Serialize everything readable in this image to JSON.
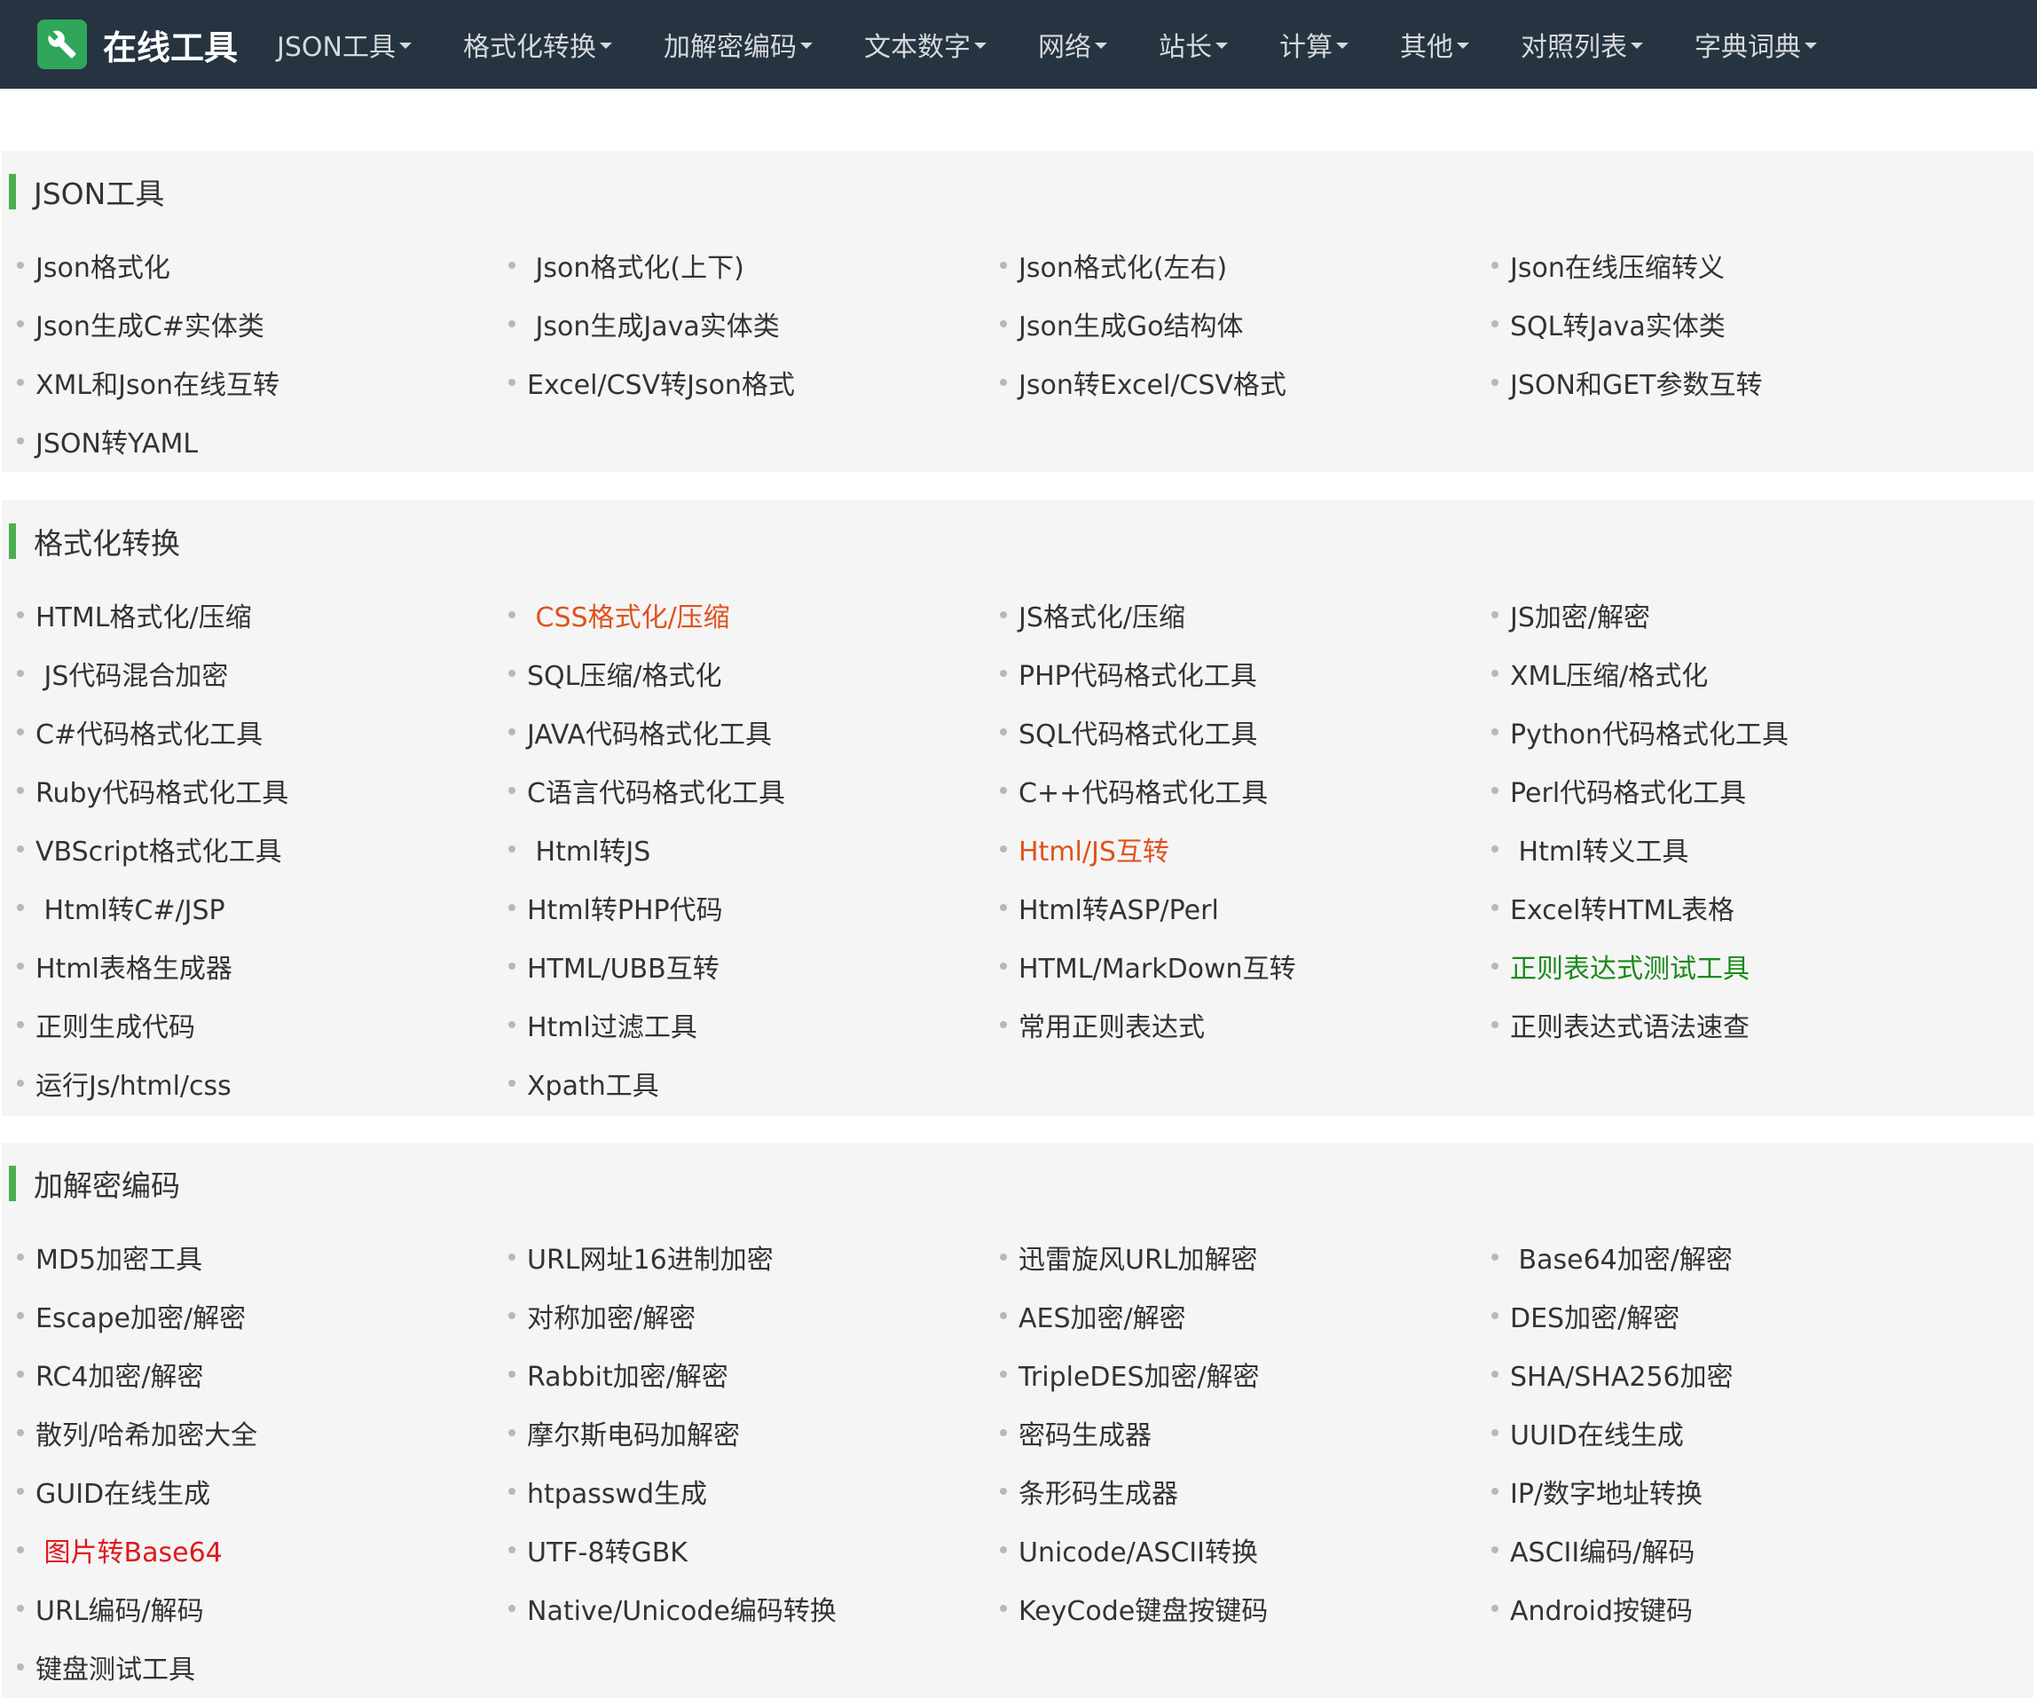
{
  "brand": {
    "title": "在线工具"
  },
  "nav": [
    "JSON工具",
    "格式化转换",
    "加解密编码",
    "文本数字",
    "网络",
    "站长",
    "计算",
    "其他",
    "对照列表",
    "字典词典"
  ],
  "colors": {
    "navbar": "#263340",
    "accent_green": "#4caf50",
    "link_orange": "#e0521c",
    "link_red": "#e0181c",
    "link_green": "#1a8a1a"
  },
  "sections": [
    {
      "title": "JSON工具",
      "links": [
        {
          "label": "Json格式化"
        },
        {
          "label": " Json格式化(上下)"
        },
        {
          "label": "Json格式化(左右)"
        },
        {
          "label": "Json在线压缩转义"
        },
        {
          "label": "Json生成C#实体类"
        },
        {
          "label": " Json生成Java实体类"
        },
        {
          "label": "Json生成Go结构体"
        },
        {
          "label": "SQL转Java实体类"
        },
        {
          "label": "XML和Json在线互转"
        },
        {
          "label": "Excel/CSV转Json格式"
        },
        {
          "label": "Json转Excel/CSV格式"
        },
        {
          "label": "JSON和GET参数互转"
        },
        {
          "label": "JSON转YAML"
        }
      ]
    },
    {
      "title": "格式化转换",
      "links": [
        {
          "label": "HTML格式化/压缩"
        },
        {
          "label": " CSS格式化/压缩",
          "color": "#e0521c"
        },
        {
          "label": "JS格式化/压缩"
        },
        {
          "label": "JS加密/解密"
        },
        {
          "label": " JS代码混合加密"
        },
        {
          "label": "SQL压缩/格式化"
        },
        {
          "label": "PHP代码格式化工具"
        },
        {
          "label": "XML压缩/格式化"
        },
        {
          "label": "C#代码格式化工具"
        },
        {
          "label": "JAVA代码格式化工具"
        },
        {
          "label": "SQL代码格式化工具"
        },
        {
          "label": "Python代码格式化工具"
        },
        {
          "label": "Ruby代码格式化工具"
        },
        {
          "label": "C语言代码格式化工具"
        },
        {
          "label": "C++代码格式化工具"
        },
        {
          "label": "Perl代码格式化工具"
        },
        {
          "label": "VBScript格式化工具"
        },
        {
          "label": " Html转JS"
        },
        {
          "label": "Html/JS互转",
          "color": "#e0521c"
        },
        {
          "label": " Html转义工具"
        },
        {
          "label": " Html转C#/JSP"
        },
        {
          "label": "Html转PHP代码"
        },
        {
          "label": "Html转ASP/Perl"
        },
        {
          "label": "Excel转HTML表格"
        },
        {
          "label": "Html表格生成器"
        },
        {
          "label": "HTML/UBB互转"
        },
        {
          "label": "HTML/MarkDown互转"
        },
        {
          "label": "正则表达式测试工具",
          "color": "#1a8a1a"
        },
        {
          "label": "正则生成代码"
        },
        {
          "label": "Html过滤工具"
        },
        {
          "label": "常用正则表达式"
        },
        {
          "label": "正则表达式语法速查"
        },
        {
          "label": "运行Js/html/css"
        },
        {
          "label": "Xpath工具"
        }
      ]
    },
    {
      "title": "加解密编码",
      "links": [
        {
          "label": "MD5加密工具"
        },
        {
          "label": "URL网址16进制加密"
        },
        {
          "label": "迅雷旋风URL加解密"
        },
        {
          "label": " Base64加密/解密"
        },
        {
          "label": "Escape加密/解密"
        },
        {
          "label": "对称加密/解密"
        },
        {
          "label": "AES加密/解密"
        },
        {
          "label": "DES加密/解密"
        },
        {
          "label": "RC4加密/解密"
        },
        {
          "label": "Rabbit加密/解密"
        },
        {
          "label": "TripleDES加密/解密"
        },
        {
          "label": "SHA/SHA256加密"
        },
        {
          "label": "散列/哈希加密大全"
        },
        {
          "label": "摩尔斯电码加解密"
        },
        {
          "label": "密码生成器"
        },
        {
          "label": "UUID在线生成"
        },
        {
          "label": "GUID在线生成"
        },
        {
          "label": "htpasswd生成"
        },
        {
          "label": "条形码生成器"
        },
        {
          "label": "IP/数字地址转换"
        },
        {
          "label": " 图片转Base64",
          "color": "#e0181c"
        },
        {
          "label": "UTF-8转GBK"
        },
        {
          "label": "Unicode/ASCII转换"
        },
        {
          "label": "ASCII编码/解码"
        },
        {
          "label": "URL编码/解码"
        },
        {
          "label": "Native/Unicode编码转换"
        },
        {
          "label": "KeyCode键盘按键码"
        },
        {
          "label": "Android按键码"
        },
        {
          "label": "键盘测试工具"
        }
      ]
    }
  ]
}
